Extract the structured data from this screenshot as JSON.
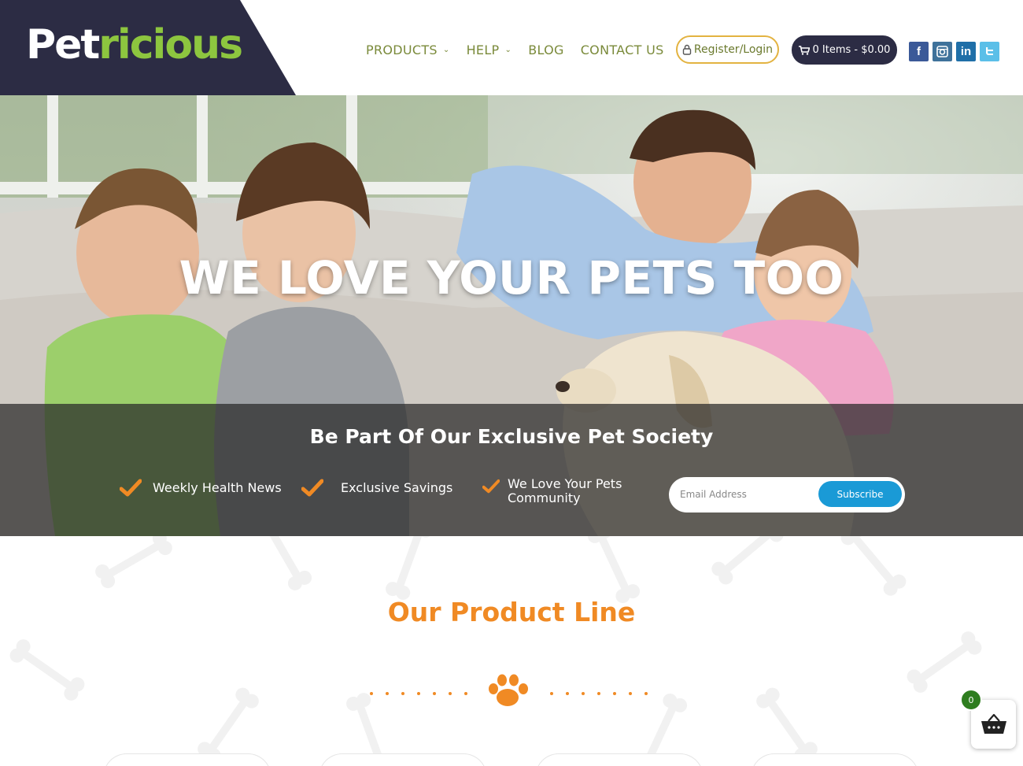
{
  "brand": {
    "logo_part1": "Pet",
    "logo_part2": "ricious",
    "dark_color": "#2c2c44",
    "green_color": "#8dc63f"
  },
  "nav": {
    "items": [
      {
        "label": "PRODUCTS",
        "has_dropdown": true
      },
      {
        "label": "HELP",
        "has_dropdown": true
      },
      {
        "label": "BLOG",
        "has_dropdown": false
      },
      {
        "label": "CONTACT US",
        "has_dropdown": false
      }
    ],
    "register_label": "Register/Login",
    "cart_label": "0 Items - $0.00"
  },
  "social": {
    "facebook": "f",
    "instagram": "instagram-icon",
    "linkedin": "in",
    "twitter": "twitter-icon"
  },
  "hero": {
    "title": "WE LOVE YOUR PETS TOO",
    "band_title": "Be Part Of Our Exclusive Pet Society",
    "features": [
      "Weekly Health News",
      "Exclusive Savings",
      "We Love Your Pets Community"
    ],
    "email_placeholder": "Email Address",
    "subscribe_label": "Subscribe",
    "accent_color": "#f08a24",
    "button_color": "#1a9ad6"
  },
  "product_section": {
    "title": "Our Product Line",
    "title_color": "#f08a24"
  },
  "floating_cart": {
    "count": "0"
  }
}
